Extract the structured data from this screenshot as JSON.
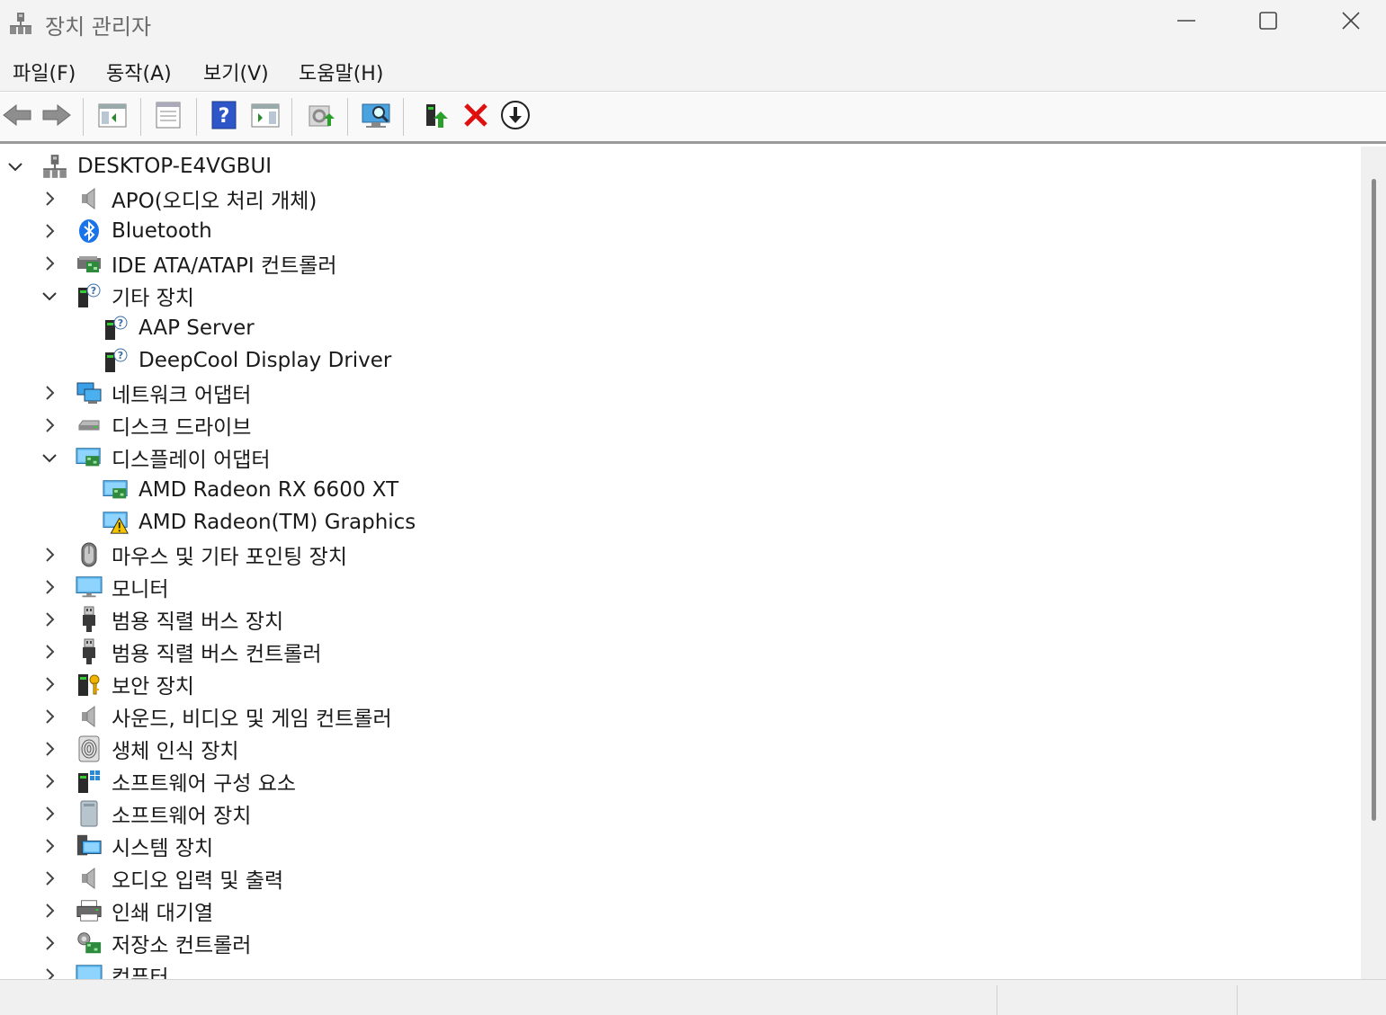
{
  "window": {
    "title": "장치 관리자",
    "minimize_icon": "minimize-icon",
    "maximize_icon": "maximize-icon",
    "close_icon": "close-icon"
  },
  "menu": {
    "file": "파일(F)",
    "action": "동작(A)",
    "view": "보기(V)",
    "help": "도움말(H)"
  },
  "toolbar": {
    "buttons": [
      "back-icon",
      "forward-icon",
      "show-hide-console-tree-icon",
      "properties-icon",
      "help-icon",
      "action-pane-icon",
      "update-driver-icon",
      "scan-hardware-icon",
      "enable-device-icon",
      "uninstall-device-icon",
      "disable-device-icon"
    ]
  },
  "tree": {
    "root": "DESKTOP-E4VGBUI",
    "categories": [
      {
        "label": "APO(오디오 처리 개체)",
        "expanded": false,
        "icon": "speaker-icon"
      },
      {
        "label": "Bluetooth",
        "expanded": false,
        "icon": "bluetooth-icon"
      },
      {
        "label": "IDE ATA/ATAPI 컨트롤러",
        "expanded": false,
        "icon": "ide-controller-icon"
      },
      {
        "label": "기타 장치",
        "expanded": true,
        "icon": "unknown-device-icon",
        "children": [
          {
            "label": "AAP Server",
            "icon": "unknown-device-icon"
          },
          {
            "label": "DeepCool Display Driver",
            "icon": "unknown-device-icon"
          }
        ]
      },
      {
        "label": "네트워크 어댑터",
        "expanded": false,
        "icon": "network-adapter-icon"
      },
      {
        "label": "디스크 드라이브",
        "expanded": false,
        "icon": "disk-drive-icon"
      },
      {
        "label": "디스플레이 어댑터",
        "expanded": true,
        "icon": "display-adapter-icon",
        "children": [
          {
            "label": "AMD Radeon RX 6600 XT",
            "icon": "display-adapter-icon"
          },
          {
            "label": "AMD Radeon(TM) Graphics",
            "icon": "display-adapter-warning-icon"
          }
        ]
      },
      {
        "label": "마우스 및 기타 포인팅 장치",
        "expanded": false,
        "icon": "mouse-icon"
      },
      {
        "label": "모니터",
        "expanded": false,
        "icon": "monitor-icon"
      },
      {
        "label": "범용 직렬 버스 장치",
        "expanded": false,
        "icon": "usb-icon"
      },
      {
        "label": "범용 직렬 버스 컨트롤러",
        "expanded": false,
        "icon": "usb-icon"
      },
      {
        "label": "보안 장치",
        "expanded": false,
        "icon": "security-device-icon"
      },
      {
        "label": "사운드, 비디오 및 게임 컨트롤러",
        "expanded": false,
        "icon": "speaker-icon"
      },
      {
        "label": "생체 인식 장치",
        "expanded": false,
        "icon": "fingerprint-icon"
      },
      {
        "label": "소프트웨어 구성 요소",
        "expanded": false,
        "icon": "software-component-icon"
      },
      {
        "label": "소프트웨어 장치",
        "expanded": false,
        "icon": "software-device-icon"
      },
      {
        "label": "시스템 장치",
        "expanded": false,
        "icon": "system-device-icon"
      },
      {
        "label": "오디오 입력 및 출력",
        "expanded": false,
        "icon": "speaker-icon"
      },
      {
        "label": "인쇄 대기열",
        "expanded": false,
        "icon": "printer-icon"
      },
      {
        "label": "저장소 컨트롤러",
        "expanded": false,
        "icon": "storage-controller-icon"
      },
      {
        "label": "컴퓨터",
        "expanded": false,
        "icon": "computer-icon"
      }
    ]
  },
  "colors": {
    "titlebar": "#f3f3f3",
    "accent": "#0078d4",
    "delete_red": "#e01010",
    "warning_yellow": "#f5c400"
  }
}
